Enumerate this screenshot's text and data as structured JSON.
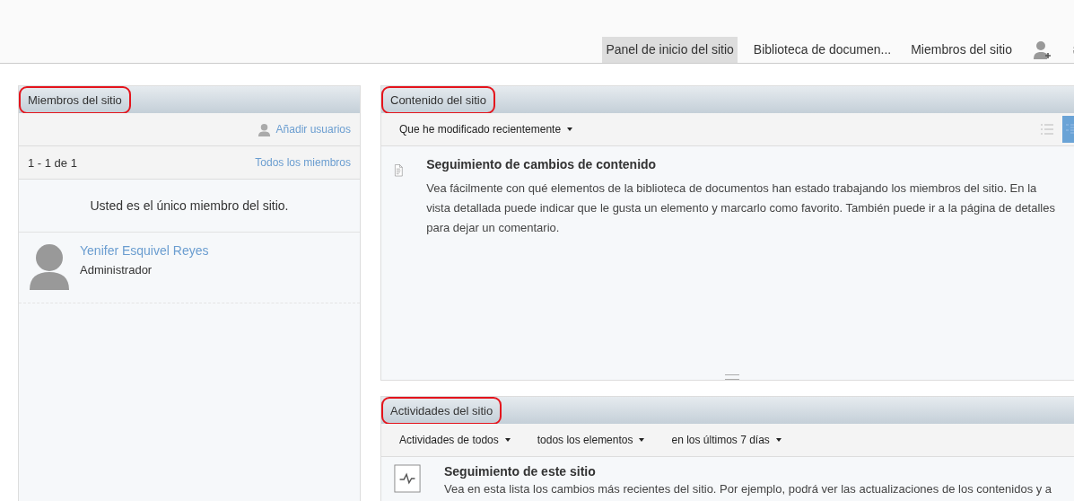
{
  "nav": {
    "tabs": [
      {
        "label": "Panel de inicio del sitio",
        "selected": true
      },
      {
        "label": "Biblioteca de documen...",
        "selected": false
      },
      {
        "label": "Miembros del sitio",
        "selected": false
      }
    ]
  },
  "members_panel": {
    "title": "Miembros del sitio",
    "highlighted": true,
    "add_users": "Añadir usuarios",
    "count": "1 - 1 de 1",
    "all_members": "Todos los miembros",
    "notice": "Usted es el único miembro del sitio.",
    "members": [
      {
        "name": "Yenifer Esquivel Reyes",
        "role": "Administrador"
      }
    ]
  },
  "content_panel": {
    "title": "Contenido del sitio",
    "highlighted": true,
    "filters": [
      "Que he modificado recientemente"
    ],
    "views": [
      {
        "kind": "simple",
        "selected": false
      },
      {
        "kind": "detailed",
        "selected": true
      }
    ],
    "heading": "Seguimiento de cambios de contenido",
    "body": "Vea fácilmente con qué elementos de la biblioteca de documentos han estado trabajando los miembros del sitio. En la vista detallada puede indicar que le gusta un elemento y marcarlo como favorito. También puede ir a la página de detalles para dejar un comentario."
  },
  "activities_panel": {
    "title": "Actividades del sitio",
    "highlighted": true,
    "filters": [
      "Actividades de todos",
      "todos los elementos",
      "en los últimos 7 días"
    ],
    "heading": "Seguimiento de este sitio",
    "body": "Vea en esta lista los cambios más recientes del sitio. Por ejemplo, podrá ver las actualizaciones de los contenidos y a"
  }
}
